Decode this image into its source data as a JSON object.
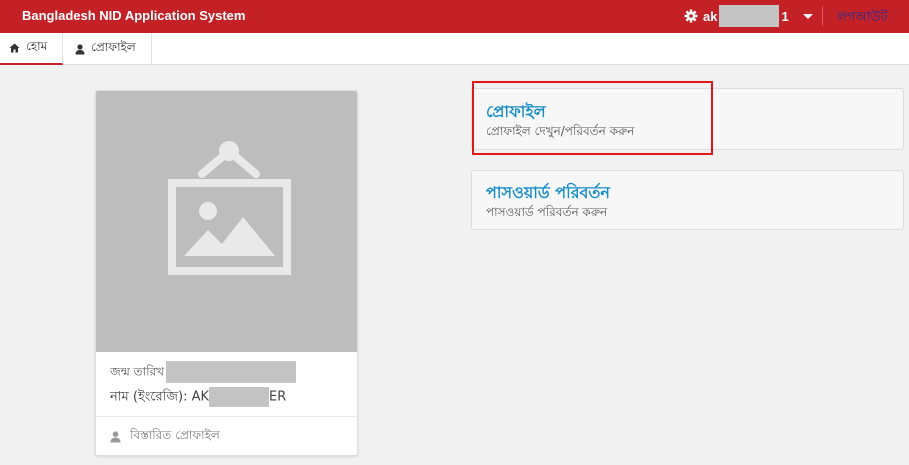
{
  "header": {
    "brand": "Bangladesh NID Application System",
    "user_prefix": "ak",
    "user_suffix": "1",
    "logout_label": "লগআউট"
  },
  "tabs": [
    {
      "label": "হোম",
      "icon": "home-icon"
    },
    {
      "label": "প্রোফাইল",
      "icon": "user-icon"
    }
  ],
  "profile_card": {
    "photo_icon": "image-placeholder-icon",
    "dob_label": "জন্ম তারিখ",
    "name_label": "নাম (ইংরেজি): AK",
    "name_suffix": "ER",
    "details_link": "বিস্তারিত প্রোফাইল"
  },
  "panels": [
    {
      "title": "প্রোফাইল",
      "subtitle": "প্রোফাইল দেখুন/পরিবর্তন করুন"
    },
    {
      "title": "পাসওয়ার্ড পরিবর্তন",
      "subtitle": "পাসওয়ার্ড পরিবর্তন করুন"
    }
  ],
  "colors": {
    "header_bg": "#c42127",
    "panel_title": "#1a8fc5",
    "highlight_border": "#e01818"
  }
}
